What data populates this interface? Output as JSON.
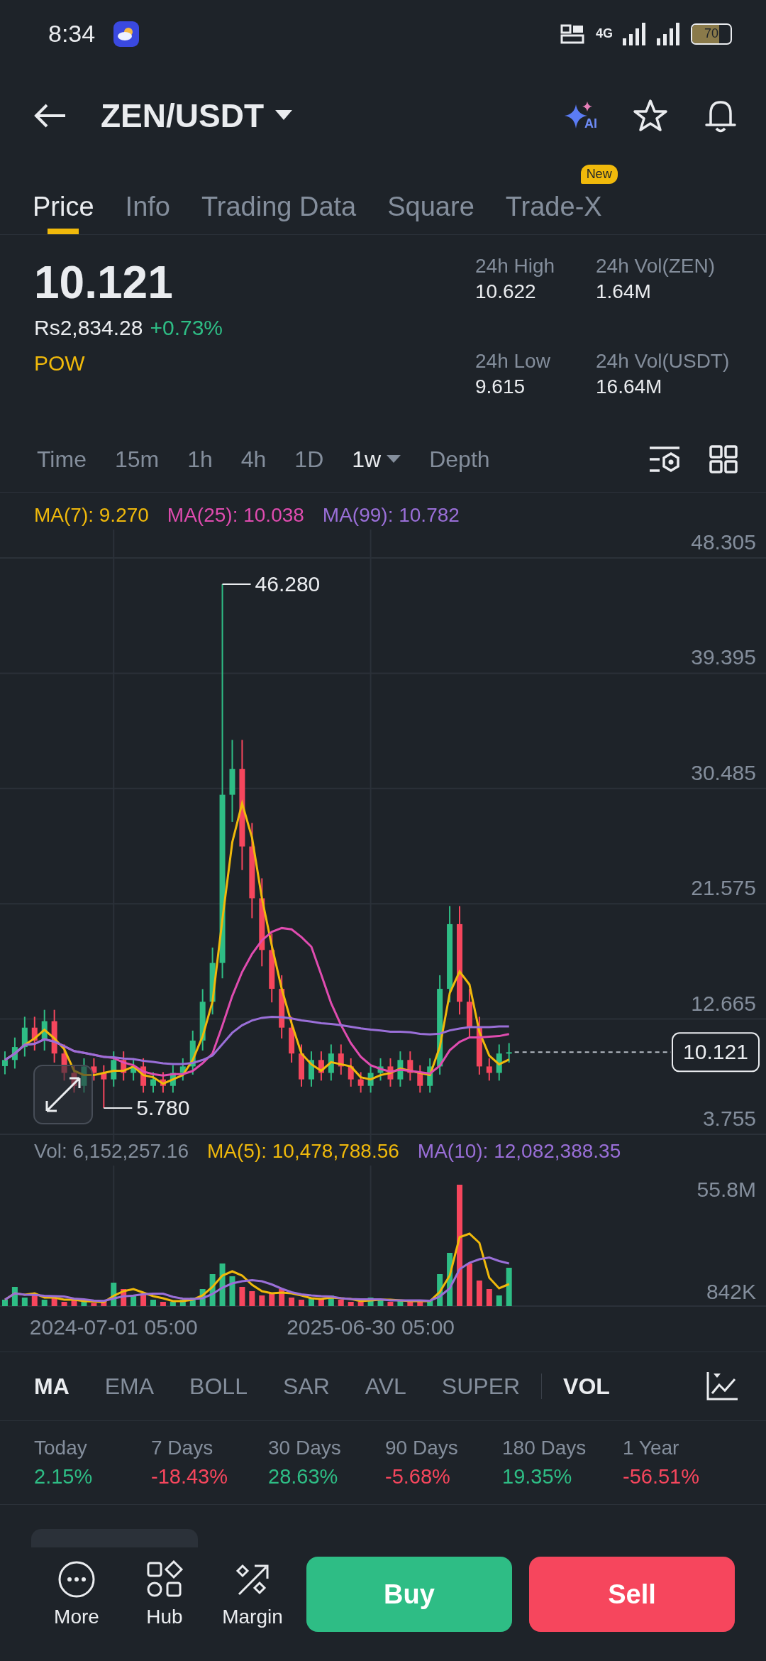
{
  "status_bar": {
    "time": "8:34",
    "network": "4G",
    "battery": "70"
  },
  "header": {
    "title": "ZEN/USDT",
    "ai_label": "AI"
  },
  "tabs": [
    {
      "label": "Price",
      "selected": true
    },
    {
      "label": "Info",
      "selected": false
    },
    {
      "label": "Trading Data",
      "selected": false
    },
    {
      "label": "Square",
      "selected": false
    },
    {
      "label": "Trade-X",
      "selected": false,
      "badge": "New"
    }
  ],
  "ticker": {
    "price": "10.121",
    "fiat": "Rs2,834.28",
    "change": "+0.73%",
    "tag": "POW",
    "stats": [
      {
        "label": "24h High",
        "value": "10.622"
      },
      {
        "label": "24h Vol(ZEN)",
        "value": "1.64M"
      },
      {
        "label": "24h Low",
        "value": "9.615"
      },
      {
        "label": "24h Vol(USDT)",
        "value": "16.64M"
      }
    ]
  },
  "intervals": [
    {
      "label": "Time",
      "selected": false
    },
    {
      "label": "15m",
      "selected": false
    },
    {
      "label": "1h",
      "selected": false
    },
    {
      "label": "4h",
      "selected": false
    },
    {
      "label": "1D",
      "selected": false
    },
    {
      "label": "1w",
      "selected": true,
      "dropdown": true
    },
    {
      "label": "Depth",
      "selected": false
    }
  ],
  "ma_legend": [
    {
      "label": "MA(7): 9.270",
      "color": "#f0b90b"
    },
    {
      "label": "MA(25): 10.038",
      "color": "#e04cb0"
    },
    {
      "label": "MA(99): 10.782",
      "color": "#9a6fd8"
    }
  ],
  "price_chart": {
    "axis_labels": [
      "48.305",
      "39.395",
      "30.485",
      "21.575",
      "12.665",
      "3.755"
    ],
    "high_marker": "46.280",
    "low_marker": "5.780",
    "current_price_tag": "10.121"
  },
  "volume_legend": [
    {
      "label": "Vol: 6,152,257.16",
      "color": "#848e9c"
    },
    {
      "label": "MA(5): 10,478,788.56",
      "color": "#f0b90b"
    },
    {
      "label": "MA(10): 12,082,388.35",
      "color": "#9a6fd8"
    }
  ],
  "volume_chart": {
    "axis_labels": [
      "55.8M",
      "842K"
    ],
    "date_labels": [
      "2024-07-01 05:00",
      "2025-06-30 05:00"
    ]
  },
  "indicators": [
    {
      "label": "MA",
      "selected": true
    },
    {
      "label": "EMA",
      "selected": false
    },
    {
      "label": "BOLL",
      "selected": false
    },
    {
      "label": "SAR",
      "selected": false
    },
    {
      "label": "AVL",
      "selected": false
    },
    {
      "label": "SUPER",
      "selected": false
    },
    {
      "label": "VOL",
      "selected": true
    }
  ],
  "performance": [
    {
      "label": "Today",
      "value": "2.15%"
    },
    {
      "label": "7 Days",
      "value": "-18.43%"
    },
    {
      "label": "30 Days",
      "value": "28.63%"
    },
    {
      "label": "90 Days",
      "value": "-5.68%"
    },
    {
      "label": "180 Days",
      "value": "19.35%"
    },
    {
      "label": "1 Year",
      "value": "-56.51%"
    }
  ],
  "bottom_bar": {
    "actions": [
      {
        "label": "More",
        "kind": "more"
      },
      {
        "label": "Hub",
        "kind": "hub"
      },
      {
        "label": "Margin",
        "kind": "margin"
      }
    ],
    "buy": "Buy",
    "sell": "Sell"
  }
}
